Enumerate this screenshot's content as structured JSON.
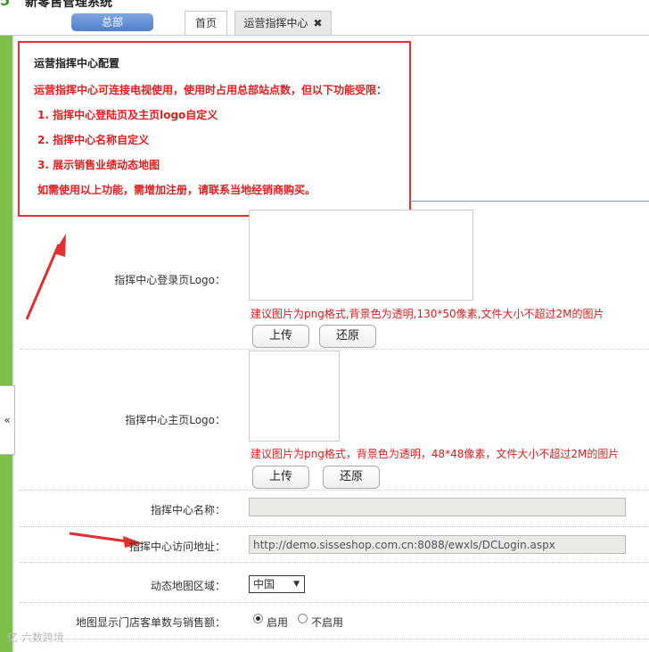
{
  "header": {
    "app_title": "新零售管理系统",
    "hq_button": "总部",
    "tabs": [
      {
        "label": "首页"
      },
      {
        "label": "运营指挥中心"
      }
    ],
    "tab_close_glyph": "✖"
  },
  "sidebar": {
    "collapse_glyph": "«"
  },
  "notice": {
    "title": "运营指挥中心配置",
    "intro": "运营指挥中心可连接电视使用，使用时占用总部站点数，但以下功能受限：",
    "items": [
      "1. 指挥中心登陆页及主页logo自定义",
      "2. 指挥中心名称自定义",
      "3. 展示销售业绩动态地图"
    ],
    "footer": "如需使用以上功能，需增加注册，请联系当地经销商购买。"
  },
  "form": {
    "login_logo": {
      "label": "指挥中心登录页Logo：",
      "hint": "建议图片为png格式,背景色为透明,130*50像素,文件大小不超过2M的图片",
      "upload": "上传",
      "restore": "还原"
    },
    "home_logo": {
      "label": "指挥中心主页Logo：",
      "hint": "建议图片为png格式，背景色为透明，48*48像素，文件大小不超过2M的图片",
      "upload": "上传",
      "restore": "还原"
    },
    "name": {
      "label": "指挥中心名称：",
      "value": ""
    },
    "url": {
      "label": "指挥中心访问地址：",
      "value": "http://demo.sisseshop.com.cn:8088/ewxls/DCLogin.aspx"
    },
    "map_region": {
      "label": "动态地图区域：",
      "value": "中国"
    },
    "show_stats": {
      "label": "地图显示门店客单数与销售额：",
      "options": [
        "启用",
        "不启用"
      ],
      "selected": "启用"
    }
  },
  "watermark": "亿 六数跨境",
  "colors": {
    "accent_green": "#7cbf4a",
    "notice_red": "#e02020",
    "hq_blue": "#5b88cc"
  }
}
